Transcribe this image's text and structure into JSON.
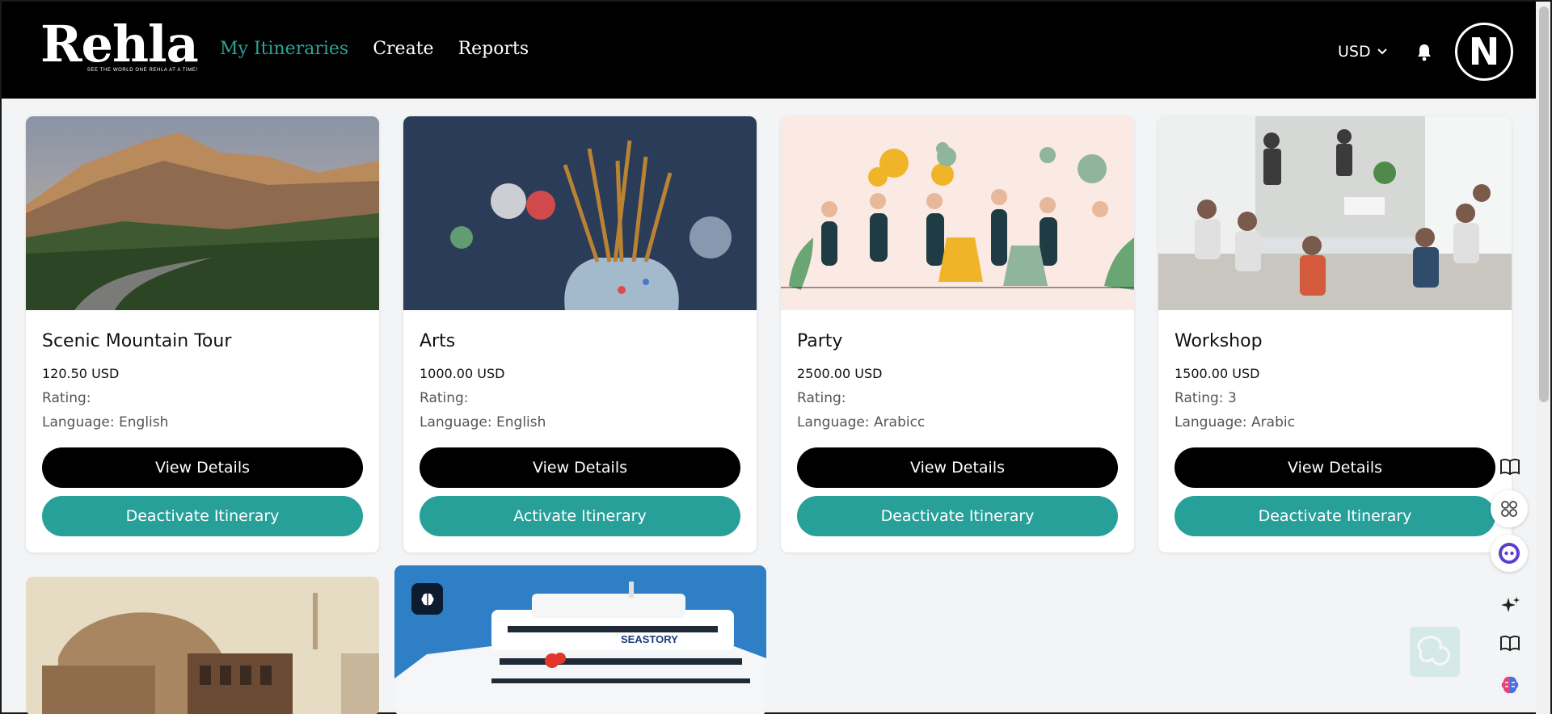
{
  "header": {
    "logo_text": "Rehla",
    "logo_tagline": "SEE THE WORLD ONE REHLA AT A TIME!",
    "nav": [
      {
        "label": "My Itineraries",
        "active": true
      },
      {
        "label": "Create",
        "active": false
      },
      {
        "label": "Reports",
        "active": false
      }
    ],
    "currency": "USD",
    "avatar_initial": "N",
    "accent_color": "#2ba39b"
  },
  "cards": [
    {
      "title": "Scenic Mountain Tour",
      "price": "120.50 USD",
      "rating": "Rating:",
      "language": "Language: English",
      "view_label": "View Details",
      "toggle_label": "Deactivate Itinerary",
      "image": "mountain-road-photo"
    },
    {
      "title": "Arts",
      "price": "1000.00 USD",
      "rating": "Rating:",
      "language": "Language: English",
      "view_label": "View Details",
      "toggle_label": "Activate Itinerary",
      "image": "paint-brushes-photo"
    },
    {
      "title": "Party",
      "price": "2500.00 USD",
      "rating": "Rating:",
      "language": "Language: Arabicc",
      "view_label": "View Details",
      "toggle_label": "Deactivate Itinerary",
      "image": "party-illustration"
    },
    {
      "title": "Workshop",
      "price": "1500.00 USD",
      "rating": "Rating: 3",
      "language": "Language: Arabic",
      "view_label": "View Details",
      "toggle_label": "Deactivate Itinerary",
      "image": "workshop-photo"
    }
  ],
  "partial_cards": [
    {
      "image": "old-mosque-photo"
    },
    {
      "image": "cruise-ship-photo",
      "ship_name": "SEASTORY"
    }
  ],
  "floating_icons": [
    "book-icon",
    "grid-icon",
    "assistant-bot-icon",
    "sparkle-icon",
    "book-open-icon",
    "brain-icon"
  ]
}
